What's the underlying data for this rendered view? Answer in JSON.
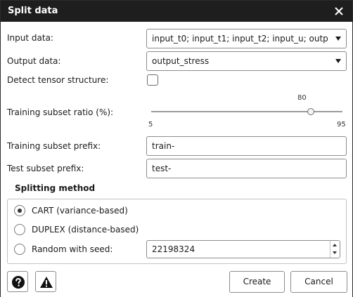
{
  "window": {
    "title": "Split data"
  },
  "fields": {
    "input_data_label": "Input data:",
    "input_data_value": "input_t0; input_t1; input_t2; input_u; outp…",
    "output_data_label": "Output data:",
    "output_data_value": "output_stress",
    "detect_tensor_label": "Detect tensor structure:",
    "detect_tensor_checked": false,
    "training_ratio_label": "Training subset ratio (%):",
    "training_ratio_value": "80",
    "training_ratio_min": "5",
    "training_ratio_max": "95",
    "training_prefix_label": "Training subset prefix:",
    "training_prefix_value": "train-",
    "test_prefix_label": "Test subset prefix:",
    "test_prefix_value": "test-"
  },
  "splitting": {
    "title": "Splitting method",
    "options": [
      {
        "label": "CART (variance-based)",
        "selected": true
      },
      {
        "label": "DUPLEX (distance-based)",
        "selected": false
      },
      {
        "label": "Random with seed:",
        "selected": false
      }
    ],
    "seed_value": "22198324"
  },
  "footer": {
    "create_label": "Create",
    "cancel_label": "Cancel"
  },
  "icons": {
    "close": "close-icon",
    "help": "help-icon",
    "warning": "warning-icon"
  },
  "colors": {
    "titlebar": "#1e1e1e",
    "border": "#8c8c8c"
  }
}
